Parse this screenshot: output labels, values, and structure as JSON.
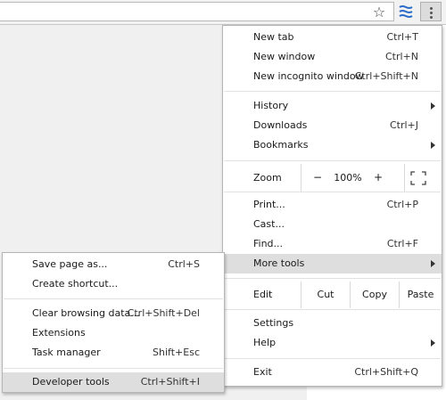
{
  "toolbar": {
    "star_icon": "bookmark-star-icon",
    "extension_icon": "extension-icon",
    "menu_icon": "three-dot-menu-icon",
    "accent_color": "#2a6ac8"
  },
  "main_menu": {
    "new_tab": {
      "label": "New tab",
      "shortcut": "Ctrl+T"
    },
    "new_window": {
      "label": "New window",
      "shortcut": "Ctrl+N"
    },
    "new_incognito": {
      "label": "New incognito window",
      "shortcut": "Ctrl+Shift+N"
    },
    "history": {
      "label": "History"
    },
    "downloads": {
      "label": "Downloads",
      "shortcut": "Ctrl+J"
    },
    "bookmarks": {
      "label": "Bookmarks"
    },
    "zoom": {
      "label": "Zoom",
      "minus": "−",
      "value": "100%",
      "plus": "+"
    },
    "print": {
      "label": "Print...",
      "shortcut": "Ctrl+P"
    },
    "cast": {
      "label": "Cast..."
    },
    "find": {
      "label": "Find...",
      "shortcut": "Ctrl+F"
    },
    "more_tools": {
      "label": "More tools"
    },
    "edit": {
      "label": "Edit",
      "cut": "Cut",
      "copy": "Copy",
      "paste": "Paste"
    },
    "settings": {
      "label": "Settings"
    },
    "help": {
      "label": "Help"
    },
    "exit": {
      "label": "Exit",
      "shortcut": "Ctrl+Shift+Q"
    }
  },
  "sub_menu": {
    "save_page": {
      "label": "Save page as...",
      "shortcut": "Ctrl+S"
    },
    "create_shortcut": {
      "label": "Create shortcut..."
    },
    "clear_browsing": {
      "label": "Clear browsing data...",
      "shortcut": "Ctrl+Shift+Del"
    },
    "extensions": {
      "label": "Extensions"
    },
    "task_manager": {
      "label": "Task manager",
      "shortcut": "Shift+Esc"
    },
    "developer_tools": {
      "label": "Developer tools",
      "shortcut": "Ctrl+Shift+I"
    }
  }
}
